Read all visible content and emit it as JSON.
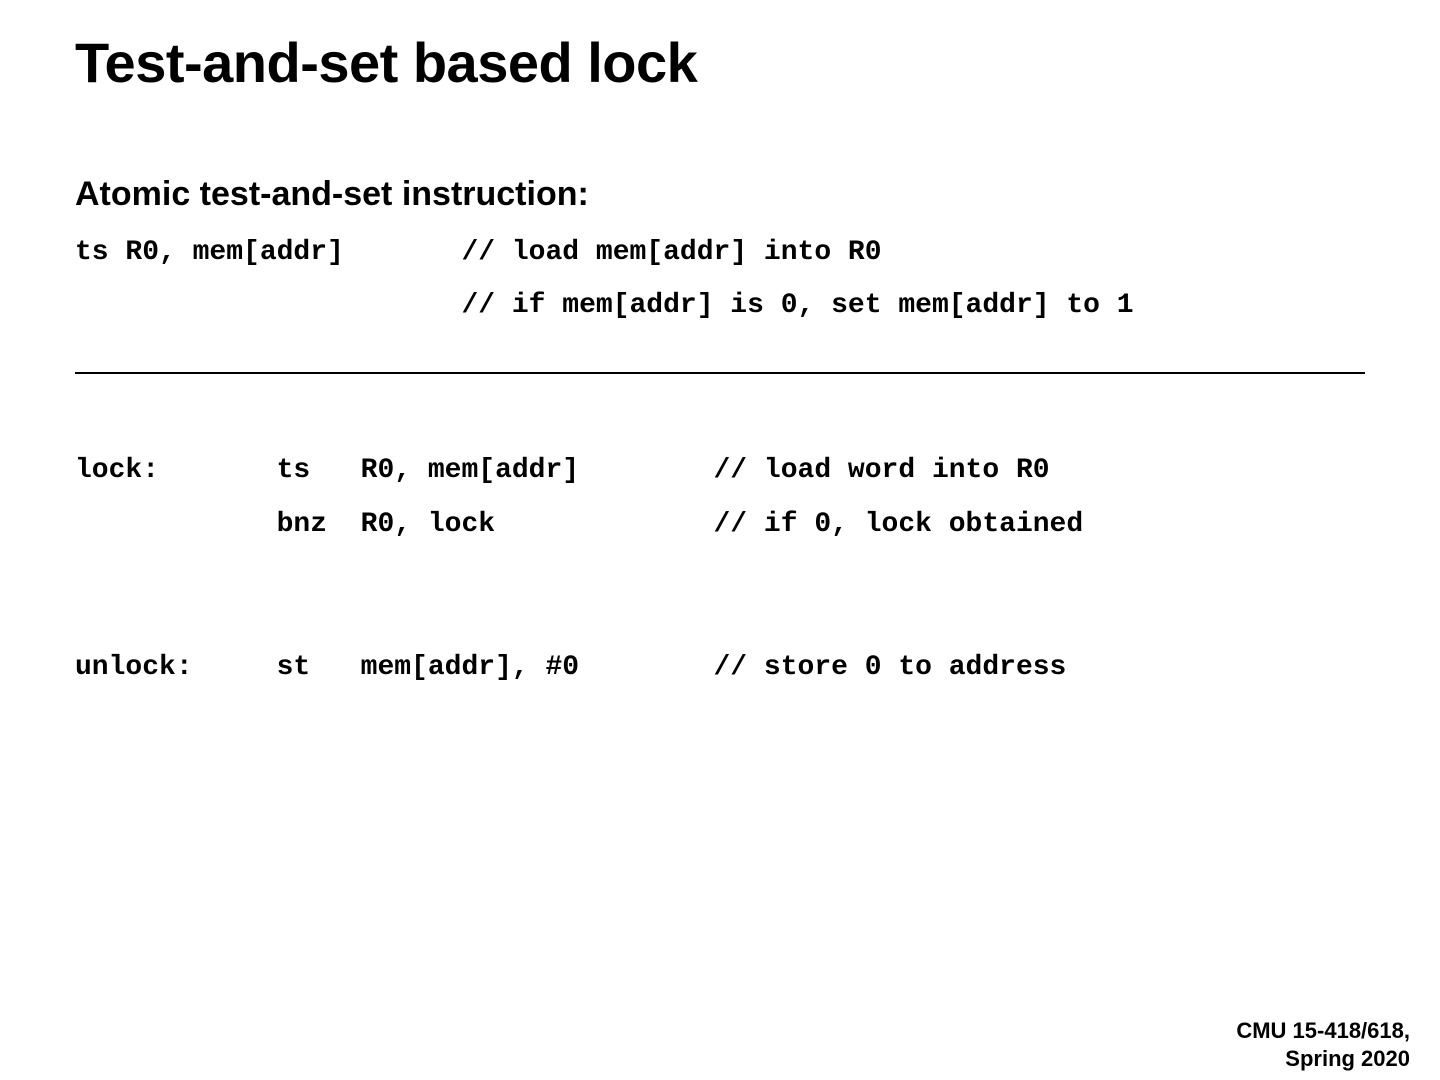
{
  "slide": {
    "title": "Test-and-set based lock",
    "section1": {
      "heading": "Atomic test-and-set instruction:",
      "code_line1": "ts R0, mem[addr]       // load mem[addr] into R0",
      "code_line2": "                       // if mem[addr] is 0, set mem[addr] to 1"
    },
    "section2": {
      "lock_line1": "lock:       ts   R0, mem[addr]        // load word into R0",
      "lock_line2": "            bnz  R0, lock             // if 0, lock obtained",
      "unlock_line1": "unlock:     st   mem[addr], #0        // store 0 to address"
    },
    "footer": {
      "line1": "CMU 15-418/618,",
      "line2": "Spring 2020"
    }
  }
}
